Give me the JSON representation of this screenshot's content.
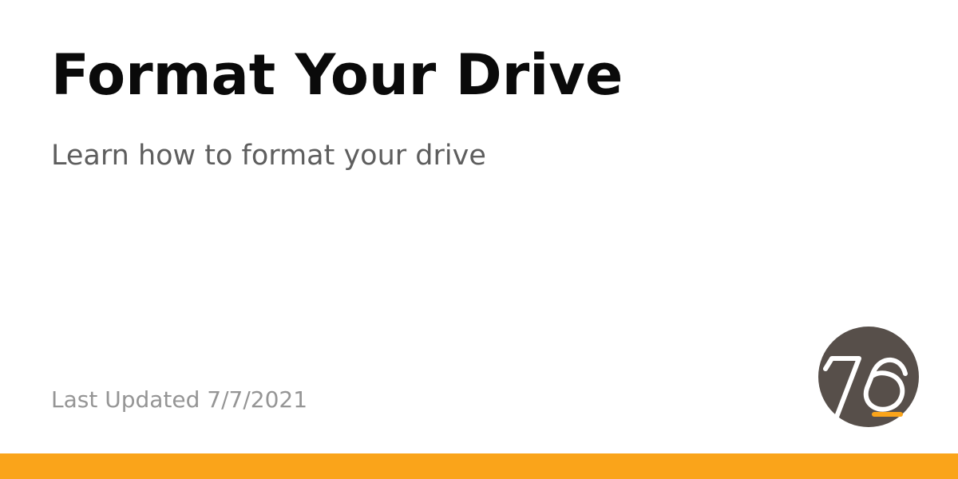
{
  "page": {
    "title": "Format Your Drive",
    "subtitle": "Learn how to format your drive",
    "last_updated": "Last Updated 7/7/2021"
  },
  "logo": {
    "name": "system76-logo",
    "circle_color": "#574f4a",
    "glyph_color": "#ffffff",
    "underline_color": "#faa41a"
  },
  "colors": {
    "accent": "#faa41a",
    "title": "#0a0a0a",
    "subtitle": "#5e5e5e",
    "meta": "#959595",
    "background": "#ffffff"
  }
}
